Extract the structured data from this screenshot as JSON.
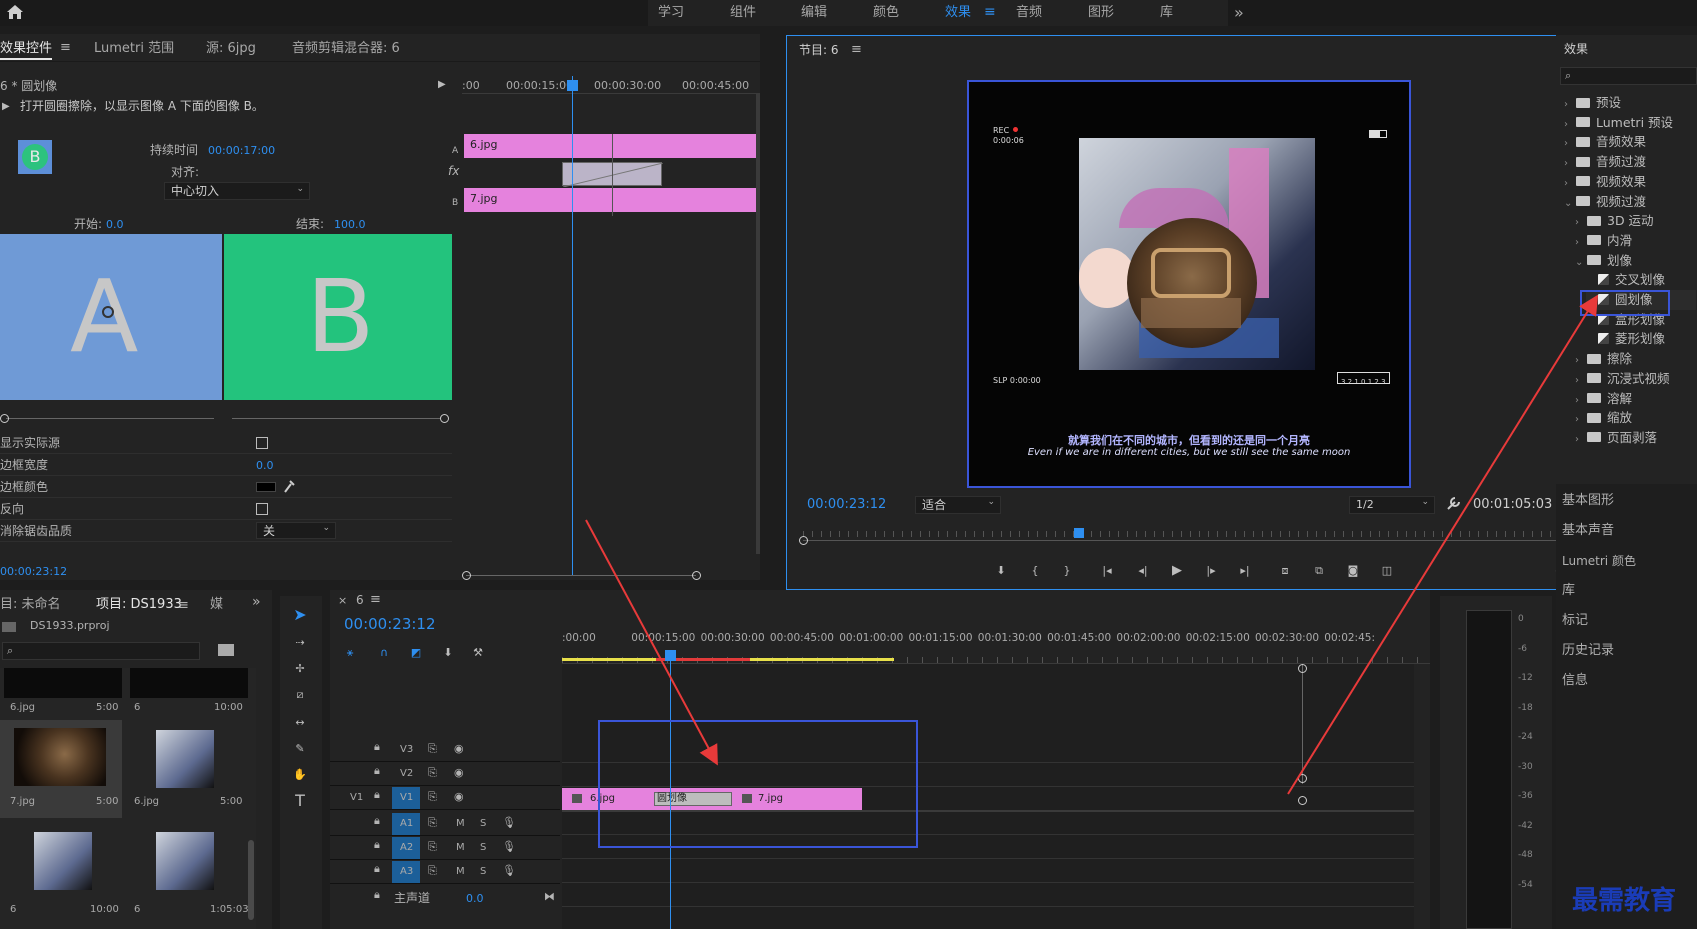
{
  "topbar": {
    "workspaces": [
      "学习",
      "组件",
      "编辑",
      "颜色",
      "效果",
      "音频",
      "图形",
      "库"
    ],
    "active_workspace": "效果",
    "more": "»"
  },
  "effect_controls": {
    "tabs": [
      "效果控件",
      "Lumetri 范围",
      "源: 6jpg",
      "音频剪辑混合器: 6"
    ],
    "clip_path": "6 * 圆划像",
    "description": "打开圆圈擦除，以显示图像 A 下面的图像 B。",
    "duration_label": "持续时间",
    "duration_value": "00:00:17:00",
    "align_label": "对齐:",
    "align_value": "中心切入",
    "start_label": "开始:",
    "start_value": "0.0",
    "end_label": "结束:",
    "end_value": "100.0",
    "letter_a": "A",
    "letter_b": "B",
    "thumb_letter": "B",
    "props": [
      {
        "label": "显示实际源",
        "value": ""
      },
      {
        "label": "边框宽度",
        "value": "0.0"
      },
      {
        "label": "边框颜色",
        "value": ""
      },
      {
        "label": "反向",
        "value": ""
      },
      {
        "label": "消除锯齿品质",
        "value": "关"
      }
    ],
    "timecode": "00:00:23:12",
    "mini_ruler": [
      ":00",
      "00:00:15:00",
      "00:00:30:00",
      "00:00:45:00"
    ],
    "track_a": "A",
    "track_b": "B",
    "clip_a": "6.jpg",
    "clip_b": "7.jpg",
    "fx": "fx"
  },
  "program": {
    "title": "节目: 6",
    "timecode": "00:00:23:12",
    "fit": "适合",
    "quality": "1/2",
    "duration": "00:01:05:03",
    "rec": "REC",
    "rec_time": "0:00:06",
    "slp": "SLP 0:00:00",
    "date_box": "3.2.1.0.1.2.3",
    "subtitle_cn": "就算我们在不同的城市，但看到的还是同一个月亮",
    "subtitle_en": "Even if we are in different cities, but we still see the same moon",
    "transport": [
      "marker-icon",
      "in-icon",
      "out-icon",
      "goto-in-icon",
      "step-back-icon",
      "play-icon",
      "step-forward-icon",
      "goto-out-icon",
      "lift-icon",
      "extract-icon",
      "camera-icon",
      "compare-icon"
    ]
  },
  "effects_panel": {
    "title": "效果",
    "items": [
      {
        "label": "预设",
        "level": 0,
        "open": false,
        "type": "star"
      },
      {
        "label": "Lumetri 预设",
        "level": 0,
        "open": false,
        "type": "star"
      },
      {
        "label": "音频效果",
        "level": 0,
        "open": false,
        "type": "folder"
      },
      {
        "label": "音频过渡",
        "level": 0,
        "open": false,
        "type": "folder"
      },
      {
        "label": "视频效果",
        "level": 0,
        "open": false,
        "type": "folder"
      },
      {
        "label": "视频过渡",
        "level": 0,
        "open": true,
        "type": "folder"
      },
      {
        "label": "3D 运动",
        "level": 1,
        "open": false,
        "type": "folder"
      },
      {
        "label": "内滑",
        "level": 1,
        "open": false,
        "type": "folder"
      },
      {
        "label": "划像",
        "level": 1,
        "open": true,
        "type": "folder"
      },
      {
        "label": "交叉划像",
        "level": 2,
        "open": false,
        "type": "fx"
      },
      {
        "label": "圆划像",
        "level": 2,
        "open": false,
        "type": "fx"
      },
      {
        "label": "盒形划像",
        "level": 2,
        "open": false,
        "type": "fx"
      },
      {
        "label": "菱形划像",
        "level": 2,
        "open": false,
        "type": "fx"
      },
      {
        "label": "擦除",
        "level": 1,
        "open": false,
        "type": "folder"
      },
      {
        "label": "沉浸式视频",
        "level": 1,
        "open": false,
        "type": "folder"
      },
      {
        "label": "溶解",
        "level": 1,
        "open": false,
        "type": "folder"
      },
      {
        "label": "缩放",
        "level": 1,
        "open": false,
        "type": "folder"
      },
      {
        "label": "页面剥落",
        "level": 1,
        "open": false,
        "type": "folder"
      }
    ],
    "side_panels": [
      "基本图形",
      "基本声音",
      "Lumetri 颜色",
      "库",
      "标记",
      "历史记录",
      "信息"
    ]
  },
  "project": {
    "tabs": [
      "目: 未命名",
      "项目: DS1933",
      "媒"
    ],
    "file": "DS1933.prproj",
    "items": [
      {
        "name": "6.jpg",
        "dur": "5:00"
      },
      {
        "name": "6",
        "dur": "10:00"
      },
      {
        "name": "7.jpg",
        "dur": "5:00"
      },
      {
        "name": "6.jpg",
        "dur": "5:00"
      },
      {
        "name": "6",
        "dur": "10:00"
      },
      {
        "name": "6",
        "dur": "1:05:03"
      }
    ]
  },
  "timeline": {
    "tab": "6",
    "timecode": "00:00:23:12",
    "ruler": [
      ":00:00",
      "00:00:15:00",
      "00:00:30:00",
      "00:00:45:00",
      "00:01:00:00",
      "00:01:15:00",
      "00:01:30:00",
      "00:01:45:00",
      "00:02:00:00",
      "00:02:15:00",
      "00:02:30:00",
      "00:02:45:"
    ],
    "video_tracks": [
      "V3",
      "V2",
      "V1"
    ],
    "audio_tracks": [
      "A1",
      "A2",
      "A3"
    ],
    "source_v1": "V1",
    "master": "主声道",
    "master_value": "0.0",
    "clip1": "6.jpg",
    "clip2": "7.jpg",
    "transition": "圆划像",
    "m": "M",
    "s": "S"
  },
  "meter": {
    "scale": [
      "0",
      "-6",
      "-12",
      "-18",
      "-24",
      "-30",
      "-36",
      "-42",
      "-48",
      "-54"
    ]
  },
  "watermark": "最需教育",
  "colors": {
    "accent": "#2e8ff0",
    "clip": "#e582dd",
    "annotation": "#3a55d8",
    "arrow": "#e83a3a"
  }
}
